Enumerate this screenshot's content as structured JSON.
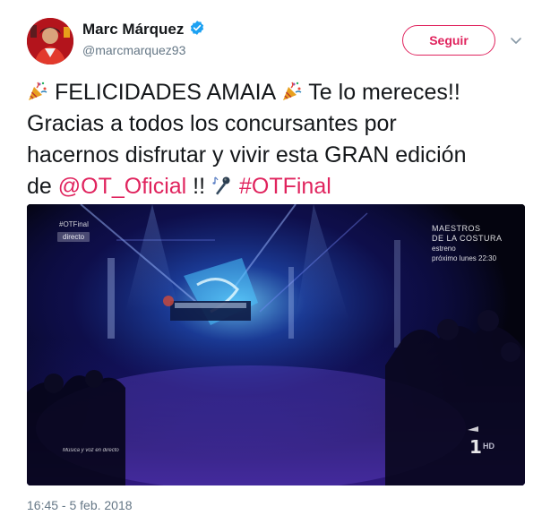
{
  "author": {
    "display_name": "Marc Márquez",
    "handle": "@marcmarquez93",
    "verified": true
  },
  "actions": {
    "follow_label": "Seguir",
    "more_icon": "chevron-down-icon"
  },
  "tweet": {
    "line1_part1": " FELICIDADES AMAIA ",
    "line1_part2": " Te lo mereces!!",
    "line2": "Gracias a todos los concursantes por",
    "line3": "hacernos disfrutar y vivir esta GRAN edición",
    "line4_prefix": "de ",
    "mention": "@OT_Oficial",
    "line4_mid": " !! ",
    "hashtag": "#OTFinal",
    "emojis": [
      "party-popper-icon",
      "party-popper-icon",
      "notes-microphone-icon"
    ]
  },
  "media": {
    "show_tag": "#OTFinal",
    "live_badge": "directo",
    "promo_line1": "MAESTROS",
    "promo_line2": "DE LA COSTURA",
    "promo_line3": "estreno",
    "promo_line4": "próximo lunes 22:30",
    "caption": "Música y voz en directo",
    "channel": "1",
    "hd": "HD"
  },
  "timestamp": "16:45 - 5 feb. 2018",
  "colors": {
    "accent": "#e0245e",
    "verified": "#1da1f2",
    "muted": "#657786",
    "text": "#14171a"
  }
}
